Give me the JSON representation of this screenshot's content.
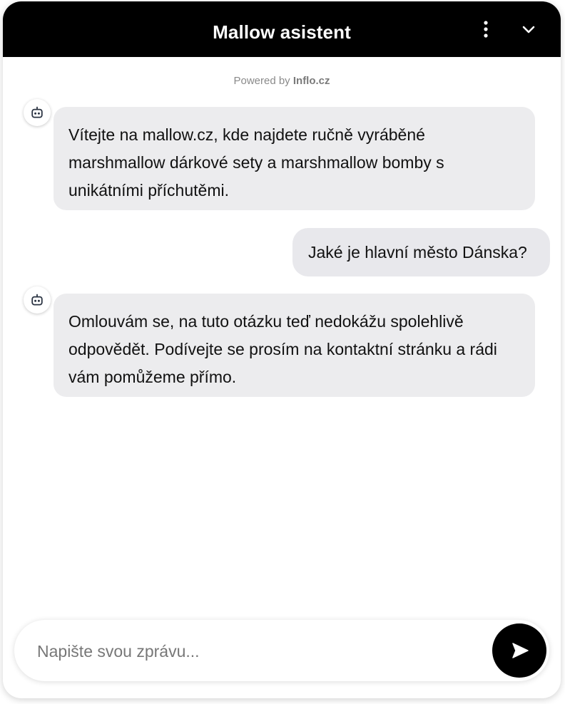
{
  "header": {
    "title": "Mallow asistent",
    "menu_icon": "vertical-dots-icon",
    "collapse_icon": "chevron-down-icon"
  },
  "powered_by": {
    "prefix": "Powered by",
    "brand": "Inflo.cz"
  },
  "messages": [
    {
      "sender": "bot",
      "avatar_icon": "bot-face-icon",
      "text": "Vítejte na mallow.cz, kde najdete ručně vyráběné marshmallow dárkové sety a marshmallow bomby s unikátními příchutěmi."
    },
    {
      "sender": "user",
      "text": "Jaké je hlavní město Dánska?"
    },
    {
      "sender": "bot",
      "avatar_icon": "bot-face-icon",
      "text": "Omlouvám se, na tuto otázku teď nedokážu spolehlivě odpovědět. Podívejte se prosím na kontaktní stránku a rádi vám pomůžeme přímo."
    }
  ],
  "composer": {
    "placeholder": "Napište svou zprávu...",
    "value": "",
    "send_icon": "send-arrow-icon"
  },
  "colors": {
    "header_bg": "#000000",
    "header_text": "#ffffff",
    "bot_bubble": "#ececee",
    "user_bubble": "#e8e8ec",
    "send_button": "#000000"
  }
}
